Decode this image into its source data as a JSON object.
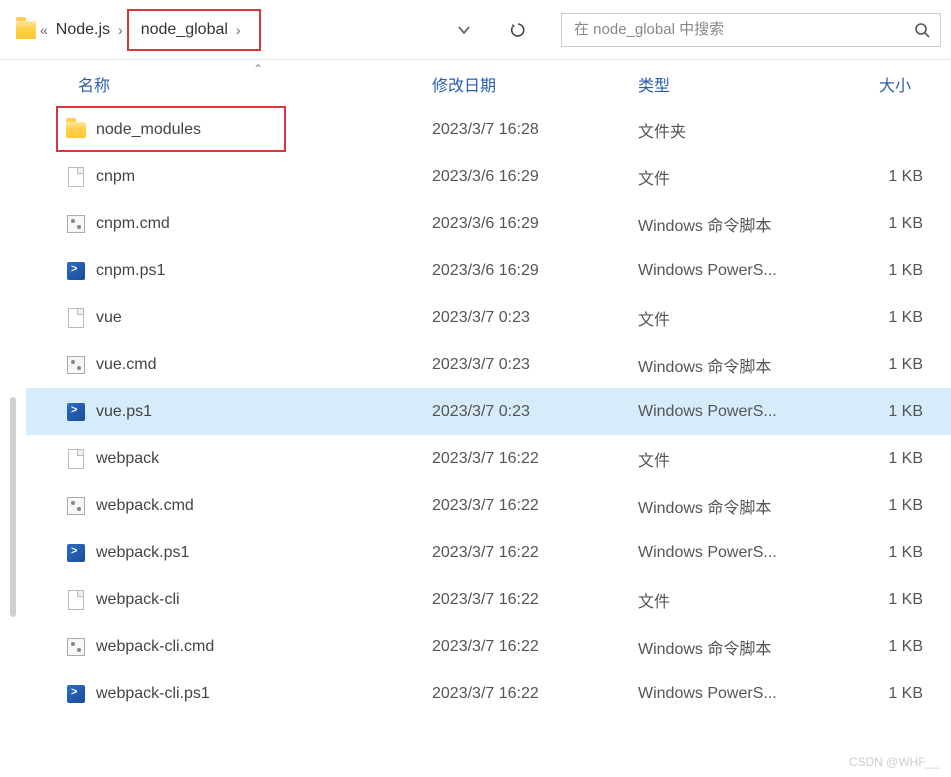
{
  "breadcrumb": {
    "ellipsis": "«",
    "parent": "Node.js",
    "current": "node_global"
  },
  "search": {
    "placeholder": "在 node_global 中搜索"
  },
  "columns": {
    "name": "名称",
    "date": "修改日期",
    "type": "类型",
    "size": "大小"
  },
  "files": [
    {
      "icon": "folder",
      "name": "node_modules",
      "date": "2023/3/7 16:28",
      "type": "文件夹",
      "size": "",
      "selected": false
    },
    {
      "icon": "file",
      "name": "cnpm",
      "date": "2023/3/6 16:29",
      "type": "文件",
      "size": "1 KB",
      "selected": false
    },
    {
      "icon": "cmd",
      "name": "cnpm.cmd",
      "date": "2023/3/6 16:29",
      "type": "Windows 命令脚本",
      "size": "1 KB",
      "selected": false
    },
    {
      "icon": "ps1",
      "name": "cnpm.ps1",
      "date": "2023/3/6 16:29",
      "type": "Windows PowerS...",
      "size": "1 KB",
      "selected": false
    },
    {
      "icon": "file",
      "name": "vue",
      "date": "2023/3/7 0:23",
      "type": "文件",
      "size": "1 KB",
      "selected": false
    },
    {
      "icon": "cmd",
      "name": "vue.cmd",
      "date": "2023/3/7 0:23",
      "type": "Windows 命令脚本",
      "size": "1 KB",
      "selected": false
    },
    {
      "icon": "ps1",
      "name": "vue.ps1",
      "date": "2023/3/7 0:23",
      "type": "Windows PowerS...",
      "size": "1 KB",
      "selected": true
    },
    {
      "icon": "file",
      "name": "webpack",
      "date": "2023/3/7 16:22",
      "type": "文件",
      "size": "1 KB",
      "selected": false
    },
    {
      "icon": "cmd",
      "name": "webpack.cmd",
      "date": "2023/3/7 16:22",
      "type": "Windows 命令脚本",
      "size": "1 KB",
      "selected": false
    },
    {
      "icon": "ps1",
      "name": "webpack.ps1",
      "date": "2023/3/7 16:22",
      "type": "Windows PowerS...",
      "size": "1 KB",
      "selected": false
    },
    {
      "icon": "file",
      "name": "webpack-cli",
      "date": "2023/3/7 16:22",
      "type": "文件",
      "size": "1 KB",
      "selected": false
    },
    {
      "icon": "cmd",
      "name": "webpack-cli.cmd",
      "date": "2023/3/7 16:22",
      "type": "Windows 命令脚本",
      "size": "1 KB",
      "selected": false
    },
    {
      "icon": "ps1",
      "name": "webpack-cli.ps1",
      "date": "2023/3/7 16:22",
      "type": "Windows PowerS...",
      "size": "1 KB",
      "selected": false
    }
  ],
  "watermark": "CSDN @WHF__"
}
